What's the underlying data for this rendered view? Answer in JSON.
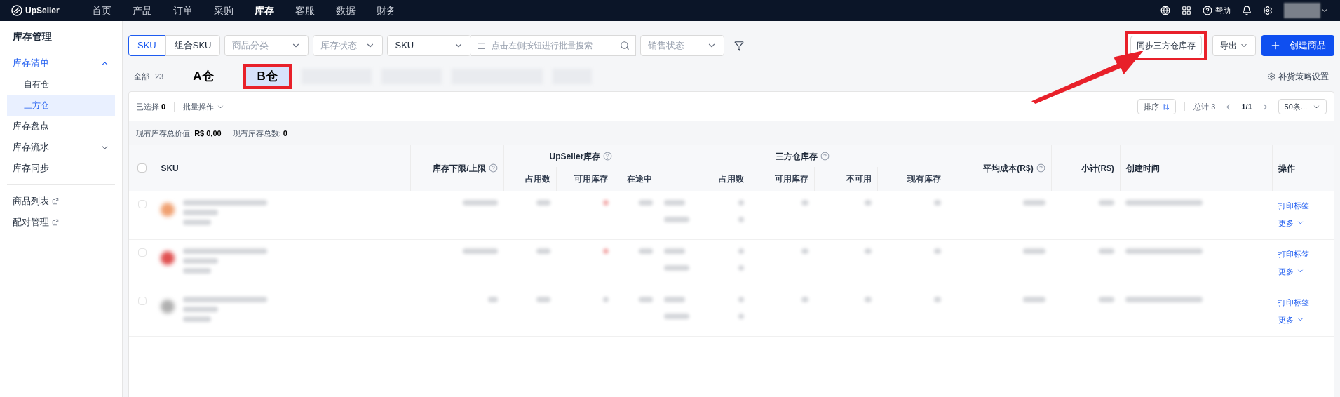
{
  "top_nav": {
    "logo": "UpSeller",
    "items": [
      {
        "label": "首页",
        "selected": false
      },
      {
        "label": "产品",
        "selected": false
      },
      {
        "label": "订单",
        "selected": false
      },
      {
        "label": "采购",
        "selected": false
      },
      {
        "label": "库存",
        "selected": true
      },
      {
        "label": "客服",
        "selected": false
      },
      {
        "label": "数据",
        "selected": false
      },
      {
        "label": "财务",
        "selected": false
      }
    ],
    "help": "帮助"
  },
  "sidebar": {
    "title": "库存管理",
    "items": [
      {
        "label": "库存清单",
        "expanded": true,
        "selected": false,
        "children": [
          {
            "label": "自有仓",
            "selected": false
          },
          {
            "label": "三方仓",
            "selected": true
          }
        ]
      },
      {
        "label": "库存盘点",
        "selected": false
      },
      {
        "label": "库存流水",
        "expanded": false,
        "selected": false
      },
      {
        "label": "库存同步",
        "selected": false
      }
    ],
    "links": [
      {
        "label": "商品列表"
      },
      {
        "label": "配对管理"
      }
    ]
  },
  "toolbar": {
    "sku_toggle": [
      {
        "label": "SKU",
        "selected": true
      },
      {
        "label": "组合SKU",
        "selected": false
      }
    ],
    "category": {
      "placeholder": "商品分类"
    },
    "stock_status": {
      "placeholder": "库存状态"
    },
    "search_type": {
      "value": "SKU"
    },
    "search": {
      "placeholder": "点击左侧按钮进行批量搜索"
    },
    "sale_status": {
      "placeholder": "销售状态"
    },
    "sync_button": "同步三方仓库存",
    "export_button": "导出",
    "create_button": "创建商品"
  },
  "warehouse_tabs": {
    "all": {
      "label": "全部",
      "count": "23"
    },
    "annotations": [
      {
        "label": "A仓",
        "highlighted": false
      },
      {
        "label": "B仓",
        "highlighted": true
      }
    ],
    "settings_link": "补货策略设置"
  },
  "table_bar": {
    "selected_label": "已选择",
    "selected_count": "0",
    "batch": "批量操作",
    "sort": "排序",
    "total": "总计 3",
    "page": "1/1",
    "page_size": "50条..."
  },
  "summary": [
    {
      "label": "现有库存总价值:",
      "value": "R$ 0,00"
    },
    {
      "label": "现有库存总数:",
      "value": "0"
    }
  ],
  "table": {
    "columns": {
      "sku": "SKU",
      "limit": "库存下限/上限",
      "upseller": "UpSeller库存",
      "upseller_sub": [
        "占用数",
        "可用库存",
        "在途中"
      ],
      "third": "三方仓库存",
      "third_sub": [
        "占用数",
        "可用库存",
        "不可用",
        "现有库存"
      ],
      "avg_cost": "平均成本(R$)",
      "subtotal": "小计(R$)",
      "created": "创建时间",
      "actions": "操作"
    },
    "select_all": {
      "checked": false
    },
    "rows": [
      {
        "checked": false,
        "color": "#f0a070",
        "actions": [
          "打印标签",
          "更多"
        ]
      },
      {
        "checked": false,
        "color": "#e05050",
        "actions": [
          "打印标签",
          "更多"
        ]
      },
      {
        "checked": false,
        "color": "#b0b0b0",
        "actions": [
          "打印标签",
          "更多"
        ]
      }
    ]
  }
}
